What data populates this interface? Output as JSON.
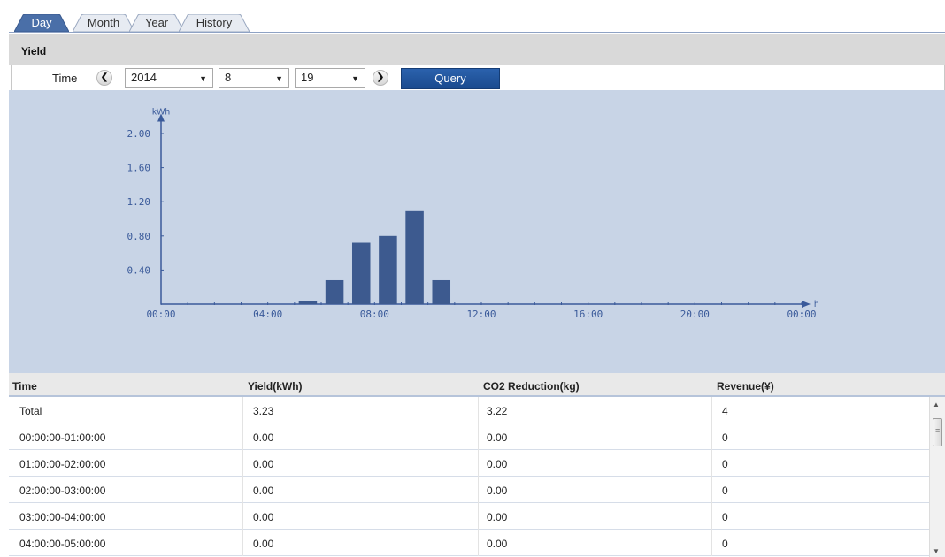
{
  "tabs": [
    {
      "label": "Day",
      "active": true
    },
    {
      "label": "Month",
      "active": false
    },
    {
      "label": "Year",
      "active": false
    },
    {
      "label": "History",
      "active": false
    }
  ],
  "section": {
    "title": "Yield"
  },
  "toolbar": {
    "time_label": "Time",
    "year": "2014",
    "month": "8",
    "day": "19",
    "query_label": "Query"
  },
  "colors": {
    "bar": "#3d5a8f",
    "axis": "#3a5a9a",
    "chart_bg": "#c8d4e6",
    "accent": "#1f4f95"
  },
  "chart_data": {
    "type": "bar",
    "xlabel": "h",
    "ylabel": "kWh",
    "x_tick_labels": [
      "00:00",
      "04:00",
      "08:00",
      "12:00",
      "16:00",
      "20:00",
      "00:00"
    ],
    "y_tick_labels": [
      "0.40",
      "0.80",
      "1.20",
      "1.60",
      "2.00"
    ],
    "ylim": [
      0,
      2.2
    ],
    "categories": [
      "00:00",
      "01:00",
      "02:00",
      "03:00",
      "04:00",
      "05:00",
      "06:00",
      "07:00",
      "08:00",
      "09:00",
      "10:00",
      "11:00",
      "12:00",
      "13:00",
      "14:00",
      "15:00",
      "16:00",
      "17:00",
      "18:00",
      "19:00",
      "20:00",
      "21:00",
      "22:00",
      "23:00"
    ],
    "values": [
      0,
      0,
      0,
      0,
      0,
      0.04,
      0.28,
      0.72,
      0.8,
      1.09,
      0.28,
      0,
      0,
      0,
      0,
      0,
      0,
      0,
      0,
      0,
      0,
      0,
      0,
      0
    ],
    "grid": false
  },
  "table": {
    "columns": [
      "Time",
      "Yield(kWh)",
      "CO2 Reduction(kg)",
      "Revenue(¥)"
    ],
    "rows": [
      [
        "Total",
        "3.23",
        "3.22",
        "4"
      ],
      [
        "00:00:00-01:00:00",
        "0.00",
        "0.00",
        "0"
      ],
      [
        "01:00:00-02:00:00",
        "0.00",
        "0.00",
        "0"
      ],
      [
        "02:00:00-03:00:00",
        "0.00",
        "0.00",
        "0"
      ],
      [
        "03:00:00-04:00:00",
        "0.00",
        "0.00",
        "0"
      ],
      [
        "04:00:00-05:00:00",
        "0.00",
        "0.00",
        "0"
      ]
    ]
  }
}
